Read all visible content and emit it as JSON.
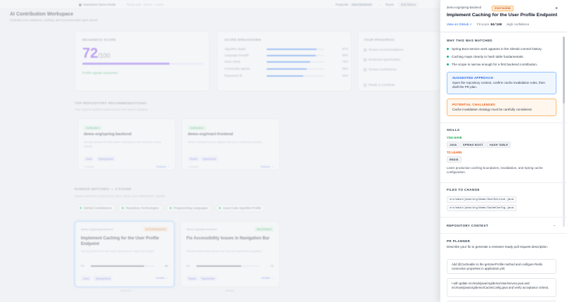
{
  "topbar": {
    "mode_label": "Interactive Demo Mode",
    "sub_label": "Read-only · Demo · Active",
    "persona_prefix": "Proportle",
    "persona_value": "Java Backend",
    "reset_label": "Reset",
    "exit_label": "Exit Demo"
  },
  "workspace": {
    "title": "AI Contribution Workspace",
    "subtitle": "Evaluate your readiness, ranking, and recommended open issues"
  },
  "readiness": {
    "label": "READINESS SCORE",
    "score": "72",
    "of": "/100",
    "percent": 72,
    "profile_status": "Profile signals connected"
  },
  "breakdown": {
    "label": "SCORE BREAKDOWN",
    "rows": [
      {
        "name": "Algorithm depth",
        "value": "87%",
        "percent": 87
      },
      {
        "name": "Language breadth",
        "value": "85%",
        "percent": 85
      },
      {
        "name": "Issue clarity",
        "value": "75%",
        "percent": 75
      },
      {
        "name": "Community signals",
        "value": "69%",
        "percent": 69
      },
      {
        "name": "Repository fit",
        "value": "64%",
        "percent": 64
      }
    ]
  },
  "progress": {
    "label": "YOUR PROGRESS",
    "items": [
      "Review recommendations",
      "Bookmark opportunities",
      "Review contributions",
      "Ready to contribute"
    ]
  },
  "recommendations": {
    "title": "TOP REPOSITORY RECOMMENDATIONS",
    "subtitle": "Your highest-ranked matches from this week's analysis",
    "repos": [
      {
        "badge": "Verification",
        "name": "demo-org/spring-backend",
        "desc": "Strong backend fit with active maintainers and frequent review activity.",
        "tags": [
          "Java",
          "Spring Boot"
        ],
        "foot": "1 Issues",
        "link": "Explore →"
      },
      {
        "badge": "Verification",
        "name": "demo-org/react-frontend",
        "desc": "Recent labelled issues aligned with your contribution profile.",
        "tags": [
          "React",
          "TypeScript"
        ],
        "foot": "1 Issues",
        "link": "Explore →"
      }
    ]
  },
  "ranked": {
    "title": "RANKED MATCHES — 2 FOUND",
    "subtitle": "Issues ranked by technical fit, issue clarity and collaboration signals",
    "filters": [
      "GitHub Contributions",
      "Repository Technologies",
      "Programming Languages",
      "Used Code Algorithm Profile"
    ],
    "issues": [
      {
        "repo": "demo-org/spring-backend",
        "badge": "INTERMEDIATE",
        "title": "Implement Caching for the User Profile Endpoint",
        "desc": "Strong backend fit with clear reproduction steps and scope.",
        "fit_label": "Fit",
        "fit_value": "84",
        "fit_percent": 84,
        "tags": [
          "Java",
          "Spring Boot"
        ],
        "details": "Details →",
        "status": "Selected"
      },
      {
        "repo": "demo-org/react-frontend",
        "badge": "BEGINNER",
        "title": "Fix Accessibility Issues in Navigation Bar",
        "desc": "Resolve ARIA label issues and improve keyboard navigation.",
        "fit_label": "Fit",
        "fit_value": "71",
        "fit_percent": 71,
        "tags": [
          "React",
          "TypeScript"
        ],
        "details": "Details →",
        "status": "Viewed"
      }
    ]
  },
  "panel": {
    "repo": "demo-org/spring-backend",
    "difficulty": "Intermediate",
    "close_icon": "×",
    "title": "Implement Caching for the User Profile Endpoint",
    "github_link": "View on GitHub",
    "ext_icon": "↗",
    "fit_label": "Fit score",
    "fit_value": "84/100",
    "confidence": "High confidence",
    "why_title": "WHY THIS WAS MATCHED",
    "why_items": [
      "Spring Boot service work appears in the GitHub commit history.",
      "Caching maps cleanly to hash table fundamentals.",
      "The scope is narrow enough for a first backend contribution."
    ],
    "approach_title": "SUGGESTED APPROACH",
    "approach_text": "Open the repository context, confirm cache invalidation rules, then draft the PR plan.",
    "challenges_title": "POTENTIAL CHALLENGES",
    "challenges_text": "Cache invalidation strategy must be carefully considered.",
    "skills_title": "SKILLS",
    "you_have_label": "YOU HAVE",
    "you_have": [
      "JAVA",
      "SPRING BOOT",
      "HASH TABLE"
    ],
    "to_learn_label": "TO LEARN",
    "to_learn": [
      "REDIS"
    ],
    "skills_note": "Learn production caching boundaries, invalidation, and Spring cache configuration.",
    "files_title": "FILES TO CHANGE",
    "files": [
      "src/main/java/org/demo/UserService.java",
      "src/main/java/org/demo/CacheConfig.java"
    ],
    "context_title": "REPOSITORY CONTEXT",
    "context_chev": "⌄",
    "planner_title": "PR PLANNER",
    "planner_desc": "Describe your fix to generate a reviewer-ready pull request description.",
    "planner_steps": [
      "Add @Cacheable to the getUserProfile method and configure Redis connection properties in application.yml.",
      "I will update src/main/java/org/demo/UserService.java and src/main/java/org/demo/CacheConfig.java and verify acceptance criteria."
    ]
  },
  "colors": {
    "accent_purple": "#7c3aed",
    "link_blue": "#2563eb",
    "success_green": "#10b981",
    "warning_orange": "#ea580c"
  }
}
